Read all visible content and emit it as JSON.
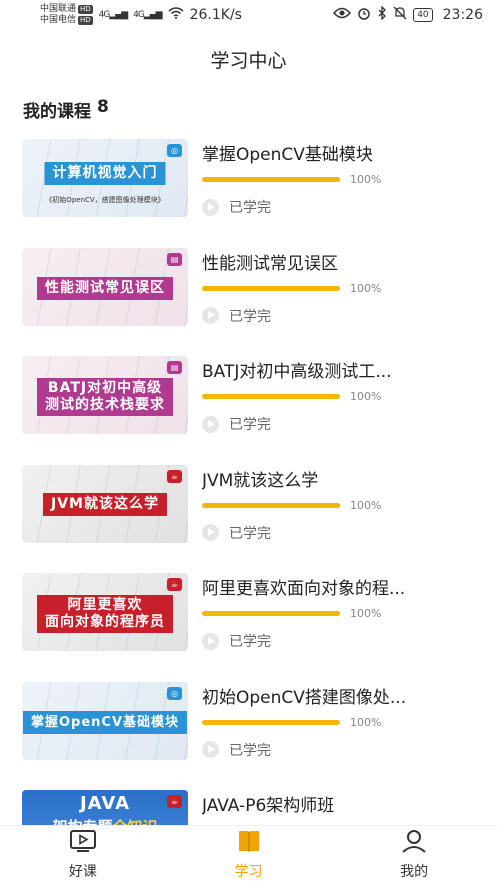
{
  "status_bar": {
    "carrier1": "中国联通",
    "carrier2": "中国电信",
    "hd": "HD",
    "net": "4G",
    "speed": "26.1K/s",
    "battery": "40",
    "time": "23:26"
  },
  "header": {
    "title": "学习中心"
  },
  "section": {
    "label": "我的课程",
    "count": "8"
  },
  "courses": [
    {
      "title": "掌握OpenCV基础模块",
      "progress_text": "100%",
      "progress": 1.0,
      "status": "已学完",
      "thumb_title": "计算机视觉入门",
      "thumb_sub": "《初始OpenCV，搭建图像处理模块》"
    },
    {
      "title": "性能测试常见误区",
      "progress_text": "100%",
      "progress": 1.0,
      "status": "已学完",
      "thumb_title": "性能测试常见误区"
    },
    {
      "title": "BATJ对初中高级测试工...",
      "progress_text": "100%",
      "progress": 1.0,
      "status": "已学完",
      "thumb_line1": "BATJ对初中高级",
      "thumb_line2": "测试的技术栈要求"
    },
    {
      "title": "JVM就该这么学",
      "progress_text": "100%",
      "progress": 1.0,
      "status": "已学完",
      "thumb_title": "JVM就该这么学"
    },
    {
      "title": "阿里更喜欢面向对象的程...",
      "progress_text": "100%",
      "progress": 1.0,
      "status": "已学完",
      "thumb_line1": "阿里更喜欢",
      "thumb_line2": "面向对象的程序员"
    },
    {
      "title": "初始OpenCV搭建图像处...",
      "progress_text": "100%",
      "progress": 1.0,
      "status": "已学完",
      "thumb_title": "掌握OpenCV基础模块"
    },
    {
      "title": "JAVA-P6架构师班",
      "thumb_big": "JAVA",
      "thumb_line2a": "架构专题",
      "thumb_line2b": "全知识"
    }
  ],
  "tabs": [
    {
      "label": "好课",
      "icon": "play-screen-icon"
    },
    {
      "label": "学习",
      "icon": "book-icon",
      "active": true
    },
    {
      "label": "我的",
      "icon": "person-icon"
    }
  ],
  "colors": {
    "accent": "#f0a500",
    "progress": "#f5b400",
    "banner_blue": "#2a93d5",
    "banner_purple": "#b03a8f",
    "banner_red": "#c8202a"
  }
}
